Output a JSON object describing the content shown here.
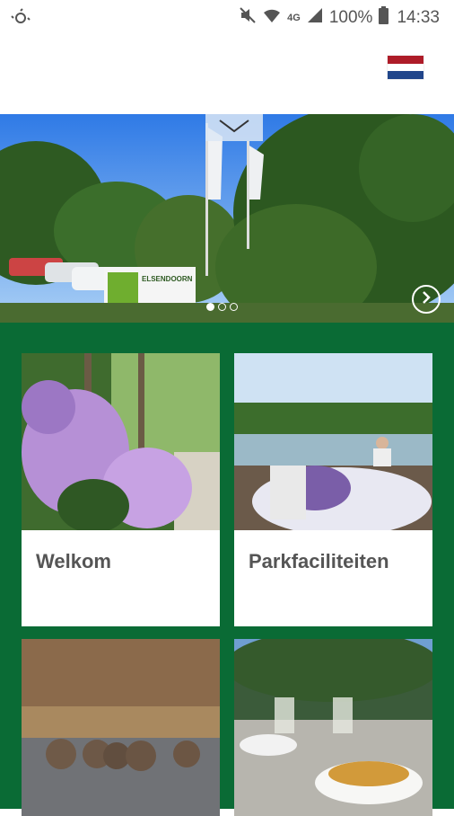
{
  "status_bar": {
    "battery_percent": "100%",
    "time": "14:33",
    "network": "4G"
  },
  "header": {
    "language_flag": "dutch-flag",
    "flag_colors": [
      "#ae1c28",
      "#ffffff",
      "#21468b"
    ]
  },
  "hero": {
    "slides_count": 3,
    "active_slide": 1,
    "sign_text": "ELSENDOORN"
  },
  "tiles": [
    {
      "label": "Welkom"
    },
    {
      "label": "Parkfaciliteiten"
    },
    {
      "label": ""
    },
    {
      "label": ""
    }
  ],
  "colors": {
    "brand_green": "#0a6b35"
  }
}
